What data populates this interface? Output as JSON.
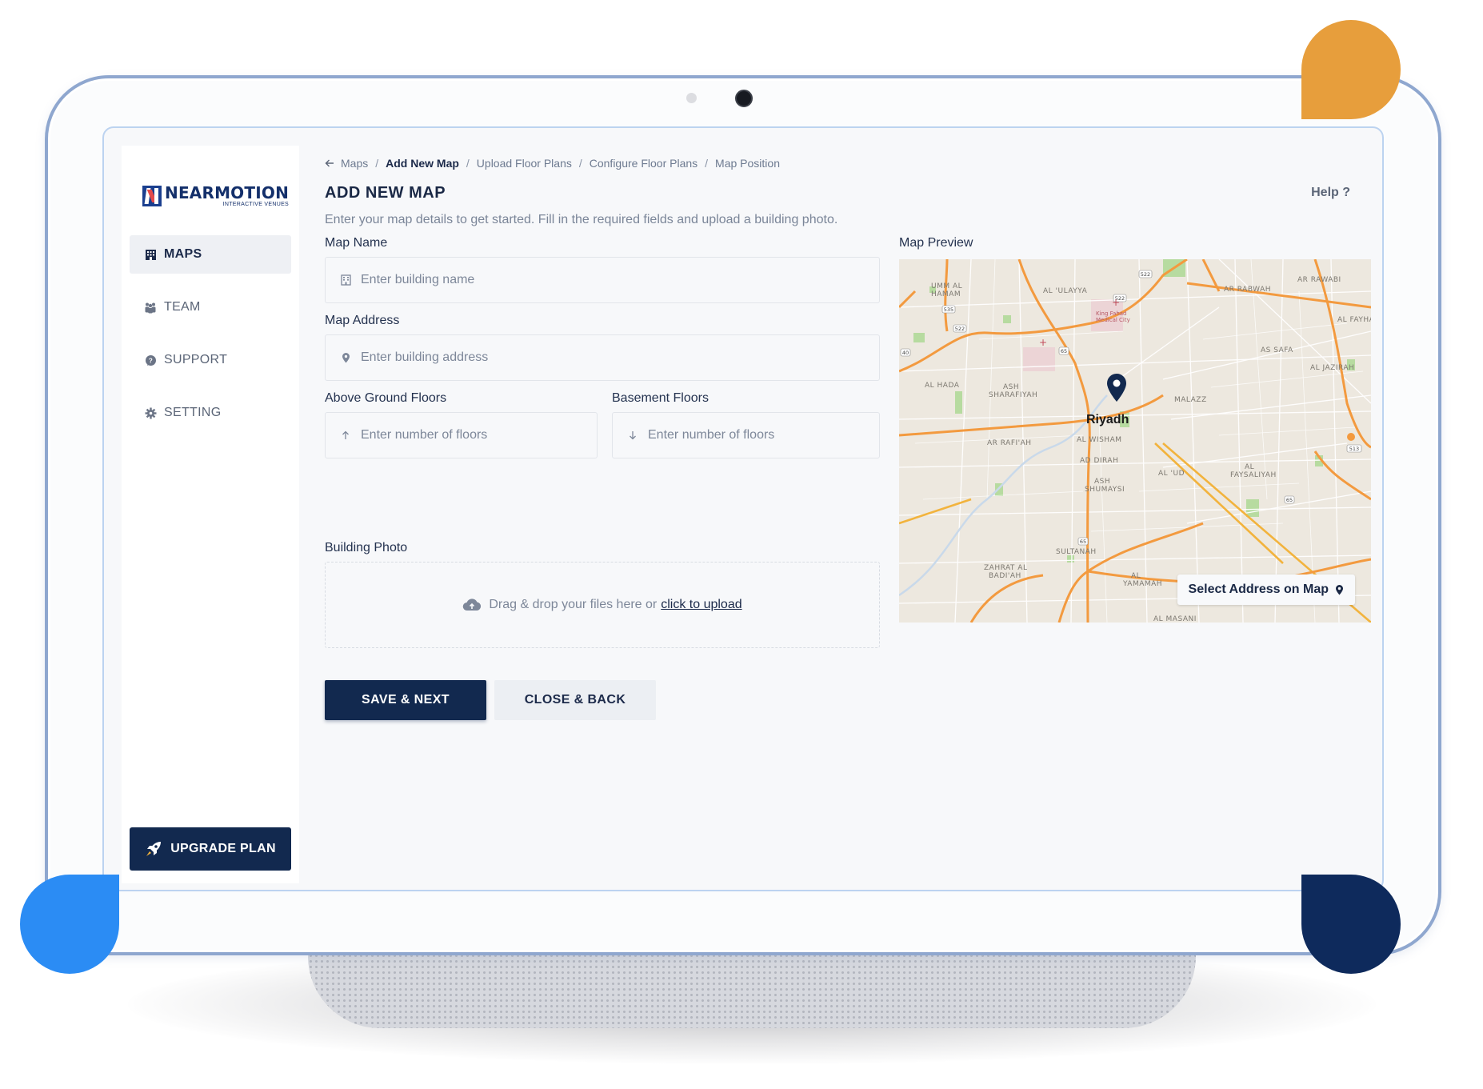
{
  "brand": {
    "name": "NEARMOTION",
    "tagline": "INTERACTIVE VENUES",
    "icon": "nearmotion-logo"
  },
  "sidebar": {
    "items": [
      {
        "label": "MAPS",
        "icon": "building-icon",
        "active": true
      },
      {
        "label": "TEAM",
        "icon": "team-icon",
        "active": false
      },
      {
        "label": "SUPPORT",
        "icon": "support-icon",
        "active": false
      },
      {
        "label": "SETTING",
        "icon": "gear-icon",
        "active": false
      }
    ],
    "upgrade_label": "UPGRADE PLAN",
    "upgrade_icon": "rocket-icon"
  },
  "breadcrumb": {
    "back_icon": "arrow-left-icon",
    "items": [
      "Maps",
      "Add New Map",
      "Upload Floor Plans",
      "Configure Floor Plans",
      "Map Position"
    ],
    "separator": "/"
  },
  "header": {
    "title": "ADD NEW MAP",
    "help_label": "Help ?",
    "subtitle": "Enter your map details to get started. Fill in the required fields and upload a building photo."
  },
  "form": {
    "map_name": {
      "label": "Map Name",
      "placeholder": "Enter building name",
      "value": "",
      "icon": "building-icon"
    },
    "map_address": {
      "label": "Map Address",
      "placeholder": "Enter building address",
      "value": "",
      "icon": "location-pin-icon"
    },
    "above_floors": {
      "label": "Above Ground Floors",
      "placeholder": "Enter number of floors",
      "value": "",
      "icon": "arrow-up-icon"
    },
    "basement_floors": {
      "label": "Basement Floors",
      "placeholder": "Enter number of floors",
      "value": "",
      "icon": "arrow-down-icon"
    },
    "building_photo": {
      "label": "Building Photo",
      "drop_text": "Drag & drop your files here or",
      "link_text": "click to upload",
      "icon": "cloud-upload-icon"
    }
  },
  "actions": {
    "save_label": "SAVE & NEXT",
    "close_label": "CLOSE & BACK"
  },
  "map_preview": {
    "label": "Map Preview",
    "city_label": "Riyadh",
    "select_address_label": "Select Address on Map",
    "select_icon": "location-pin-icon",
    "districts": [
      "UMM AL HAMAM",
      "AL ULAYYA",
      "AR RABWAH",
      "AR RAWABI",
      "AL FAYHA",
      "AS SAFA",
      "AL JAZIRAH",
      "AL HADA",
      "ASH SHARAFIYAH",
      "AR RAFI'AH",
      "AL WISHAM",
      "AD DIRAH",
      "AL 'UD",
      "ASH SHUMAYSI",
      "AL FAYSALIYAH",
      "SULTANAH",
      "ZAHRAT AL BADI'AH",
      "AL YAMAMAH",
      "AL MASANI",
      "MALAZZ"
    ],
    "poi_labels": [
      "King Fahad Medical City"
    ],
    "road_shields": [
      "522",
      "535",
      "40",
      "65",
      "513"
    ],
    "colors": {
      "land": "#ede8df",
      "major_road": "#f39a3f",
      "highway": "#f2b33d",
      "park": "#b7dba0",
      "pin": "#12294f"
    }
  },
  "decor_colors": {
    "orange": "#e79e3c",
    "blue": "#2b8cf4",
    "navy": "#0e2a5c",
    "frame": "#8fa7cf"
  }
}
